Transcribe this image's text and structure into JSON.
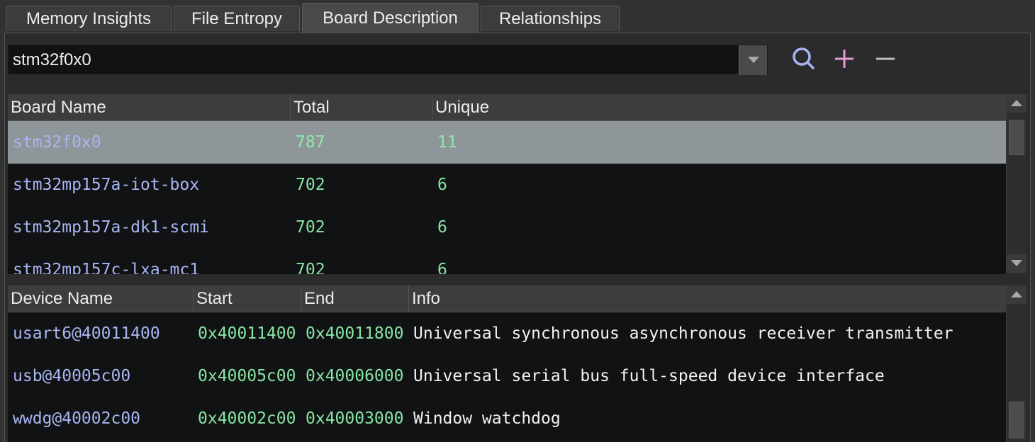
{
  "tabs": [
    {
      "label": "Memory Insights"
    },
    {
      "label": "File Entropy"
    },
    {
      "label": "Board Description"
    },
    {
      "label": "Relationships"
    }
  ],
  "board_select": {
    "value": "stm32f0x0"
  },
  "toolbar": {
    "search_icon": "search-icon",
    "add_icon": "plus-icon",
    "remove_icon": "minus-icon",
    "colors": {
      "search": "#a6b4f5",
      "add": "#e79ad9",
      "remove": "#bdbdbd"
    }
  },
  "boards_table": {
    "columns": [
      "Board Name",
      "Total",
      "Unique"
    ],
    "rows": [
      {
        "name": "stm32f0x0",
        "total": "787",
        "unique": "11",
        "selected": true
      },
      {
        "name": "stm32mp157a-iot-box",
        "total": "702",
        "unique": "6"
      },
      {
        "name": "stm32mp157a-dk1-scmi",
        "total": "702",
        "unique": "6"
      },
      {
        "name": "stm32mp157c-lxa-mc1",
        "total": "702",
        "unique": "6"
      }
    ]
  },
  "devices_table": {
    "columns": [
      "Device Name",
      "Start",
      "End",
      "Info"
    ],
    "rows": [
      {
        "name": "usart6@40011400",
        "start": "0x40011400",
        "end": "0x40011800",
        "info": "Universal synchronous asynchronous receiver transmitter"
      },
      {
        "name": "usb@40005c00",
        "start": "0x40005c00",
        "end": "0x40006000",
        "info": "Universal serial bus full-speed device interface"
      },
      {
        "name": "wwdg@40002c00",
        "start": "0x40002c00",
        "end": "0x40003000",
        "info": "Window watchdog"
      }
    ]
  }
}
